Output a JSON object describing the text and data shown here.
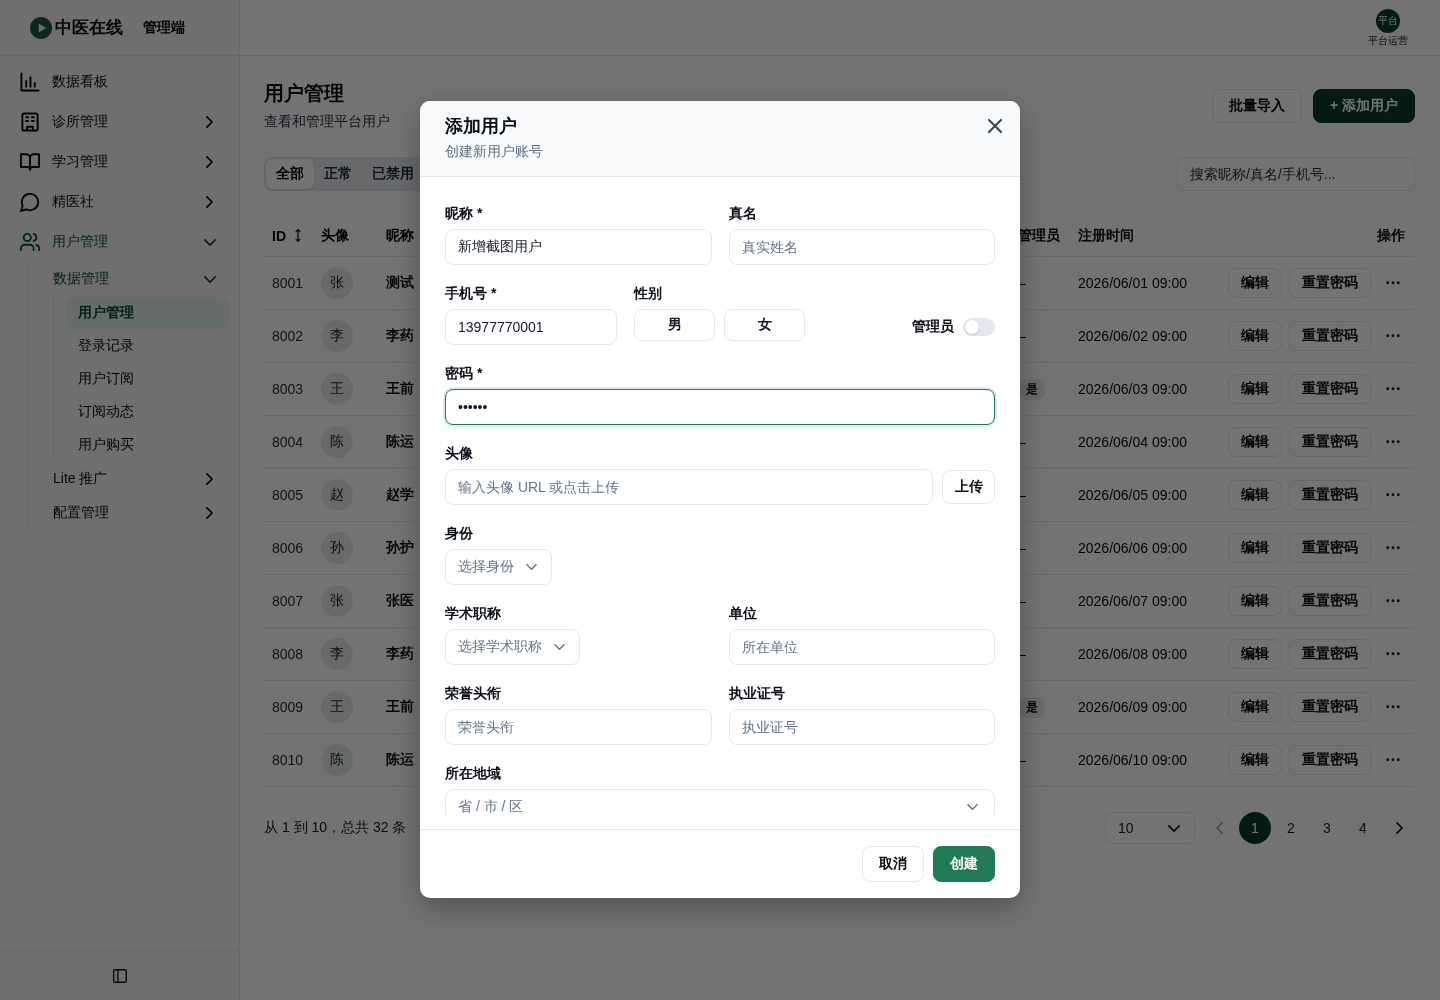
{
  "app": {
    "brand": "中医在线",
    "brand_suffix": "管理端"
  },
  "account": {
    "avatar_text": "平台",
    "role": "平台运营"
  },
  "sidebar": {
    "items": [
      {
        "kind": "link",
        "label": "数据看板",
        "selected": false
      },
      {
        "kind": "group",
        "label": "诊所管理",
        "expanded": false
      },
      {
        "kind": "group",
        "label": "学习管理",
        "expanded": false
      },
      {
        "kind": "group",
        "label": "精医社",
        "expanded": false
      },
      {
        "kind": "group",
        "label": "用户管理",
        "expanded": true,
        "children": [
          {
            "kind": "group",
            "label": "数据管理",
            "expanded": true,
            "children": [
              {
                "kind": "link",
                "label": "用户管理",
                "selected": true
              },
              {
                "kind": "link",
                "label": "登录记录",
                "selected": false
              },
              {
                "kind": "link",
                "label": "用户订阅",
                "selected": false
              },
              {
                "kind": "link",
                "label": "订阅动态",
                "selected": false
              },
              {
                "kind": "link",
                "label": "用户购买",
                "selected": false
              }
            ]
          },
          {
            "kind": "group",
            "label": "Lite 推广",
            "expanded": false
          },
          {
            "kind": "group",
            "label": "配置管理",
            "expanded": false
          }
        ]
      }
    ]
  },
  "page": {
    "title": "用户管理",
    "subtitle": "查看和管理平台用户",
    "actions": [
      {
        "label": "批量导入",
        "kind": "secondary"
      },
      {
        "label": "+ 添加用户",
        "kind": "primary"
      }
    ]
  },
  "filters": {
    "tabs": [
      {
        "label": "全部",
        "selected": true
      },
      {
        "label": "正常",
        "selected": false
      },
      {
        "label": "已禁用",
        "selected": false
      }
    ],
    "search": {
      "placeholder": "搜索昵称/真名/手机号..."
    }
  },
  "table": {
    "columns": [
      {
        "label": "ID",
        "sortable": true
      },
      {
        "label": "头像",
        "sortable": false
      },
      {
        "label": "昵称",
        "sortable": false
      },
      {
        "label": "管理员",
        "sortable": false
      },
      {
        "label": "注册时间",
        "sortable": false
      },
      {
        "label": "操作",
        "sortable": false
      }
    ],
    "rows": [
      {
        "id": "8001",
        "avatar": "张",
        "nickname": "测试",
        "admin": {
          "kind": "none",
          "text": "–"
        },
        "registered": "2026/06/01 09:00",
        "actions": [
          "编辑",
          "重置密码"
        ]
      },
      {
        "id": "8002",
        "avatar": "李",
        "nickname": "李药",
        "admin": {
          "kind": "none",
          "text": "–"
        },
        "registered": "2026/06/02 09:00",
        "actions": [
          "编辑",
          "重置密码"
        ]
      },
      {
        "id": "8003",
        "avatar": "王",
        "nickname": "王前",
        "admin": {
          "kind": "badge",
          "text": "是"
        },
        "registered": "2026/06/03 09:00",
        "actions": [
          "编辑",
          "重置密码"
        ]
      },
      {
        "id": "8004",
        "avatar": "陈",
        "nickname": "陈运",
        "admin": {
          "kind": "none",
          "text": "–"
        },
        "registered": "2026/06/04 09:00",
        "actions": [
          "编辑",
          "重置密码"
        ]
      },
      {
        "id": "8005",
        "avatar": "赵",
        "nickname": "赵学",
        "admin": {
          "kind": "none",
          "text": "–"
        },
        "registered": "2026/06/05 09:00",
        "actions": [
          "编辑",
          "重置密码"
        ]
      },
      {
        "id": "8006",
        "avatar": "孙",
        "nickname": "孙护",
        "admin": {
          "kind": "none",
          "text": "–"
        },
        "registered": "2026/06/06 09:00",
        "actions": [
          "编辑",
          "重置密码"
        ]
      },
      {
        "id": "8007",
        "avatar": "张",
        "nickname": "张医",
        "admin": {
          "kind": "none",
          "text": "–"
        },
        "registered": "2026/06/07 09:00",
        "actions": [
          "编辑",
          "重置密码"
        ]
      },
      {
        "id": "8008",
        "avatar": "李",
        "nickname": "李药",
        "admin": {
          "kind": "none",
          "text": "–"
        },
        "registered": "2026/06/08 09:00",
        "actions": [
          "编辑",
          "重置密码"
        ]
      },
      {
        "id": "8009",
        "avatar": "王",
        "nickname": "王前",
        "admin": {
          "kind": "badge",
          "text": "是"
        },
        "registered": "2026/06/09 09:00",
        "actions": [
          "编辑",
          "重置密码"
        ]
      },
      {
        "id": "8010",
        "avatar": "陈",
        "nickname": "陈运",
        "admin": {
          "kind": "none",
          "text": "–"
        },
        "registered": "2026/06/10 09:00",
        "actions": [
          "编辑",
          "重置密码"
        ]
      }
    ]
  },
  "pagination": {
    "summary": "从 1 到 10，总共 32 条",
    "page_size": "10",
    "prev_disabled": true,
    "next_disabled": false,
    "pages": [
      {
        "label": "1",
        "selected": true
      },
      {
        "label": "2",
        "selected": false
      },
      {
        "label": "3",
        "selected": false
      },
      {
        "label": "4",
        "selected": false
      }
    ]
  },
  "dialog": {
    "title": "添加用户",
    "subtitle": "创建新用户账号",
    "rows": [
      {
        "fields": [
          {
            "kind": "text",
            "label": "昵称 *",
            "value": "新增截图用户",
            "focused": false
          },
          {
            "kind": "text",
            "label": "真名",
            "placeholder": "真实姓名",
            "focused": false
          }
        ]
      },
      {
        "fields": [
          {
            "kind": "text",
            "label": "手机号 *",
            "value": "13977770001",
            "focused": false
          },
          {
            "kind": "segmented",
            "label": "性别",
            "options": [
              {
                "label": "男",
                "selected": false
              },
              {
                "label": "女",
                "selected": false
              }
            ]
          },
          {
            "kind": "switch",
            "label": "管理员",
            "on": false
          }
        ]
      },
      {
        "fields": [
          {
            "kind": "password",
            "label": "密码 *",
            "value": "••••••",
            "focused": true
          }
        ]
      },
      {
        "fields": [
          {
            "kind": "upload",
            "label": "头像",
            "placeholder": "输入头像 URL 或点击上传",
            "button": "上传",
            "focused": false
          }
        ]
      },
      {
        "fields": [
          {
            "kind": "select",
            "label": "身份",
            "placeholder": "选择身份",
            "focused": false
          }
        ]
      },
      {
        "fields": [
          {
            "kind": "select",
            "label": "学术职称",
            "placeholder": "选择学术职称",
            "focused": false
          },
          {
            "kind": "text",
            "label": "单位",
            "placeholder": "所在单位",
            "focused": false
          }
        ]
      },
      {
        "fields": [
          {
            "kind": "text",
            "label": "荣誉头衔",
            "placeholder": "荣誉头衔",
            "focused": false
          },
          {
            "kind": "text",
            "label": "执业证号",
            "placeholder": "执业证号",
            "focused": false
          }
        ]
      },
      {
        "fields": [
          {
            "kind": "cascader",
            "label": "所在地域",
            "placeholder": "省 / 市 / 区",
            "focused": false
          }
        ]
      }
    ],
    "buttons": [
      {
        "label": "取消",
        "kind": "secondary"
      },
      {
        "label": "创建",
        "kind": "primary"
      }
    ]
  }
}
